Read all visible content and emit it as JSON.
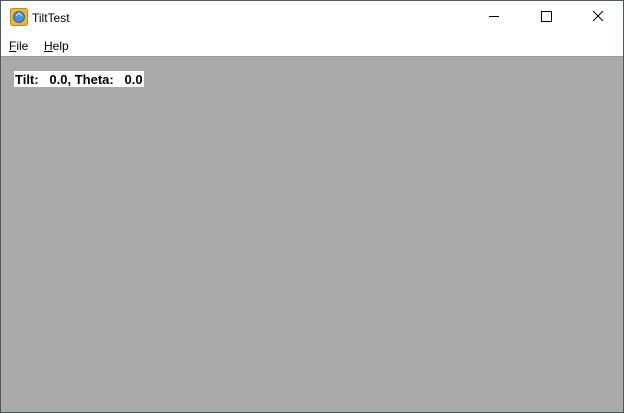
{
  "window": {
    "title": "TiltTest",
    "icon": "app-icon",
    "controls": {
      "minimize_icon": "minimize-icon",
      "maximize_icon": "maximize-icon",
      "close_icon": "close-icon"
    }
  },
  "menu": {
    "items": [
      {
        "mnemonic": "F",
        "rest": "ile"
      },
      {
        "mnemonic": "H",
        "rest": "elp"
      }
    ]
  },
  "client": {
    "background_color": "#aaaaaa",
    "readout_text": "Tilt:   0.0, Theta:   0.0"
  }
}
